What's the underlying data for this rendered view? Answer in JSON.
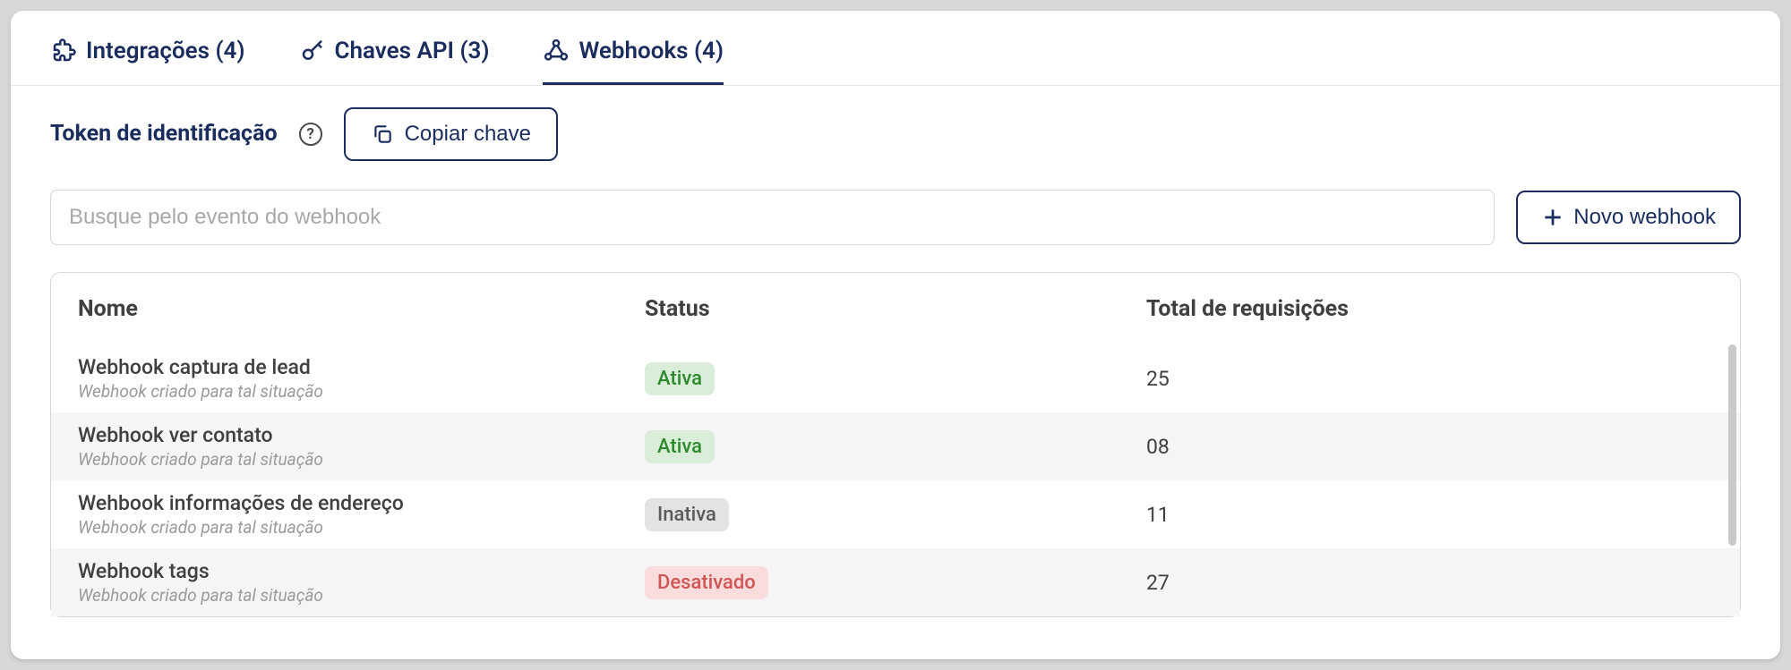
{
  "tabs": [
    {
      "label": "Integrações (4)"
    },
    {
      "label": "Chaves API (3)"
    },
    {
      "label": "Webhooks (4)"
    }
  ],
  "activeTab": 2,
  "token": {
    "label": "Token de identificação",
    "copy_label": "Copiar chave"
  },
  "search": {
    "placeholder": "Busque pelo evento do webhook"
  },
  "new_button": "Novo webhook",
  "table": {
    "headers": {
      "name": "Nome",
      "status": "Status",
      "requests": "Total de requisições"
    },
    "rows": [
      {
        "name": "Webhook captura de lead",
        "desc": "Webhook criado para tal situação",
        "status": "Ativa",
        "requests": "25"
      },
      {
        "name": "Webhook ver contato",
        "desc": "Webhook criado para tal situação",
        "status": "Ativa",
        "requests": "08"
      },
      {
        "name": "Wehbook informações de endereço",
        "desc": "Webhook criado para tal situação",
        "status": "Inativa",
        "requests": "11"
      },
      {
        "name": "Webhook tags",
        "desc": "Webhook criado para tal situação",
        "status": "Desativado",
        "requests": "27"
      }
    ]
  }
}
